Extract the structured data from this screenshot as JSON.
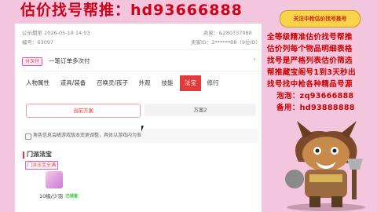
{
  "headline": "估价找号帮推：hd93666888",
  "meta": {
    "publish_label": "公示期至 2026-05-18 14:03",
    "seller_label": "卖家：&280737988",
    "id_label": "编号：63097",
    "seller_id_label": "卖家ID：2******88（9位ID）"
  },
  "install": {
    "badge": "分次付",
    "text": "一笔订单多次付",
    "chevron": "›"
  },
  "tabs": [
    {
      "label": "人物属性"
    },
    {
      "label": "道具/装备"
    },
    {
      "label": "召唤灵/孩子"
    },
    {
      "label": "外观"
    },
    {
      "label": "技能"
    },
    {
      "label": "法宝"
    },
    {
      "label": "修行"
    }
  ],
  "active_tab_index": 5,
  "schemes": {
    "a": "当前方案",
    "b": "方案2"
  },
  "notice": "角色信息会随游戏版本变更调整，具体以游戏内为准",
  "section": {
    "title": "门派法宝",
    "badge": "门派法宝全满"
  },
  "item": {
    "label": "10级/少羽",
    "tag": "已装备"
  },
  "ad": {
    "button": "关注中枪估价找号推号",
    "lines": [
      "全等级精准估价找号帮推",
      "估价列每个物品明细表格",
      "找号是严格列表估价筛选",
      "帮推藏宝阁号1到3天秒出",
      "找号找中枪各种精品号源",
      "泡泡：zq93666888",
      "备用：hd93888888"
    ]
  },
  "colors": {
    "brand_red": "#d0021b",
    "tab_active": "#e43a3a",
    "frame_pink": "#f4c6dd",
    "ad_button": "#f9d34a"
  }
}
